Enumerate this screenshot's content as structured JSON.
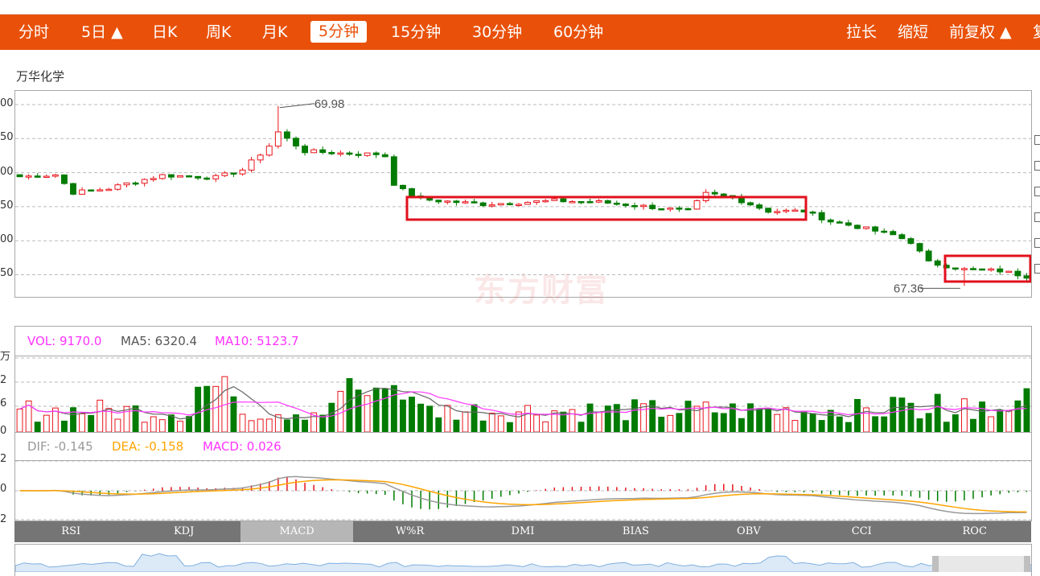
{
  "toolbar": {
    "tabs": [
      "分时",
      "5日 ▲",
      "日K",
      "周K",
      "月K",
      "5分钟",
      "15分钟",
      "30分钟",
      "60分钟"
    ],
    "active": "5分钟",
    "right": [
      "拉长",
      "缩短",
      "前复权 ▲",
      "复"
    ]
  },
  "stock_name": "万华化学",
  "colors": {
    "up": "#e8141b",
    "down": "#017b01",
    "toolbar": "#e9510a",
    "ma5": "#666666",
    "ma10": "#ff33ff",
    "dea": "#ffa500"
  },
  "price_axis_labels": [
    "00",
    "50",
    "00",
    "50",
    "00",
    "50"
  ],
  "vol_axis_labels": [
    "万",
    "2",
    "6",
    "6",
    "0"
  ],
  "macd_axis_labels": [
    "2",
    "0",
    "2"
  ],
  "max_label": "69.98",
  "min_label": "67.36",
  "watermark": "东方财富",
  "vol_legend": {
    "vol": "VOL: 9170.0",
    "ma5": "MA5: 6320.4",
    "ma10": "MA10: 5123.7"
  },
  "macd_legend": {
    "dif": "DIF: -0.145",
    "dea": "DEA: -0.158",
    "macd": "MACD: 0.026"
  },
  "indicators": [
    "RSI",
    "KDJ",
    "MACD",
    "W%R",
    "DMI",
    "BIAS",
    "OBV",
    "CCI",
    "ROC"
  ],
  "active_indicator": "MACD",
  "chart_data": {
    "type": "candlestick",
    "title": "万华化学",
    "x_count": 114,
    "ylim": [
      67.2,
      70.2
    ],
    "annotations": {
      "max": 69.98,
      "min": 67.36
    },
    "close_anchors": [
      [
        0,
        68.95
      ],
      [
        4,
        68.98
      ],
      [
        6,
        68.72
      ],
      [
        10,
        68.78
      ],
      [
        12,
        68.85
      ],
      [
        16,
        68.97
      ],
      [
        22,
        68.94
      ],
      [
        25,
        69.05
      ],
      [
        28,
        69.4
      ],
      [
        29,
        69.6
      ],
      [
        30,
        69.5
      ],
      [
        32,
        69.32
      ],
      [
        38,
        69.28
      ],
      [
        40,
        69.28
      ],
      [
        41,
        69.25
      ],
      [
        42,
        68.85
      ],
      [
        43,
        68.75
      ],
      [
        45,
        68.62
      ],
      [
        52,
        68.55
      ],
      [
        60,
        68.6
      ],
      [
        65,
        68.58
      ],
      [
        70,
        68.52
      ],
      [
        75,
        68.45
      ],
      [
        77,
        68.7
      ],
      [
        80,
        68.65
      ],
      [
        84,
        68.45
      ],
      [
        88,
        68.45
      ],
      [
        91,
        68.3
      ],
      [
        94,
        68.22
      ],
      [
        98,
        68.1
      ],
      [
        100,
        68.0
      ],
      [
        102,
        67.7
      ],
      [
        106,
        67.6
      ],
      [
        110,
        67.58
      ],
      [
        113,
        67.5
      ]
    ],
    "volume_ylim": [
      0,
      16000
    ],
    "volume_last": 9170.0,
    "macd_ylim": [
      -0.3,
      0.3
    ],
    "macd_last": {
      "dif": -0.145,
      "dea": -0.158,
      "macd": 0.026
    }
  }
}
